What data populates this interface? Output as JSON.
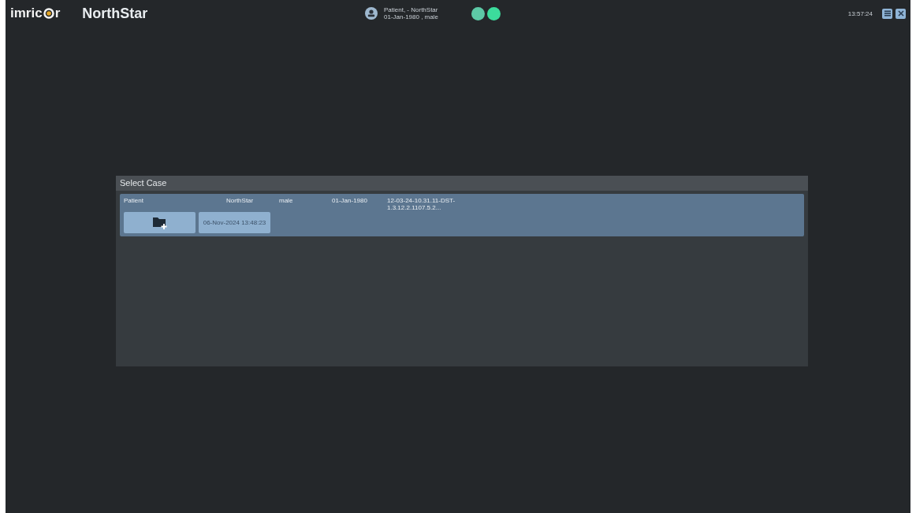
{
  "header": {
    "logo": "imric",
    "logo_tail": "r",
    "app_title": "NorthStar",
    "patient_line_1": "Patient, - NorthStar",
    "patient_line_2": "01-Jan-1980 , male",
    "status_lights": [
      {
        "color": "#5dc9a6"
      },
      {
        "color": "#3cdc9c"
      }
    ],
    "clock": "13:57:24"
  },
  "dialog": {
    "title": "Select Case",
    "cases": [
      {
        "columns": [
          "Patient",
          "NorthStar",
          "male",
          "01-Jan-1980",
          "12-03-24-10.31.11-DST-1.3.12.2.1107.5.2..."
        ],
        "sessions": [
          "06-Nov-2024 13:48:23"
        ]
      }
    ]
  }
}
